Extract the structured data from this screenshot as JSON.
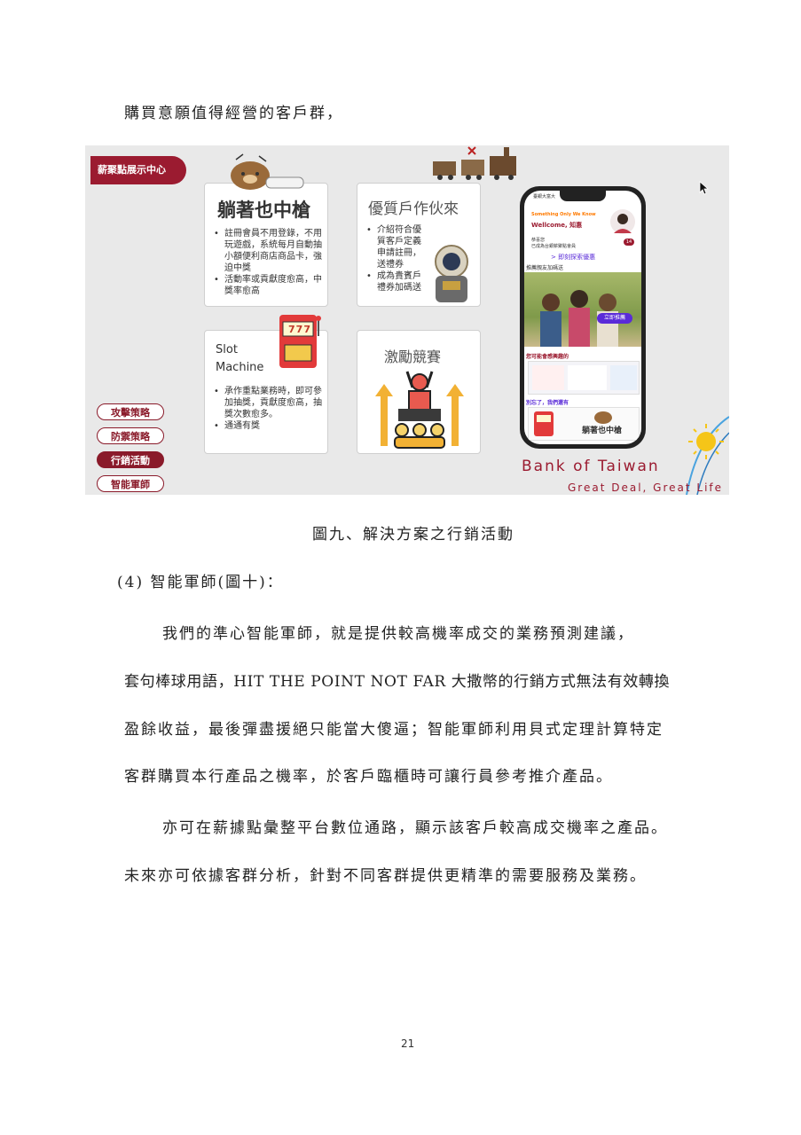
{
  "intro_line": "購買意願值得經營的客戶群，",
  "slide": {
    "tag": "薪聚點展示中心",
    "card1": {
      "title": "躺著也中槍",
      "bullets": [
        "註冊會員不用登錄，不用玩遊戲，系統每月自動抽小額便利商店商品卡，強迫中獎",
        "活動率或貢獻度愈高，中獎率愈高"
      ]
    },
    "card2": {
      "title": "優質戶作伙來",
      "bullets": [
        "介紹符合優質客戶定義申請註冊，送禮券",
        "成為貴賓戶禮券加碼送"
      ]
    },
    "card3": {
      "title_line1": "Slot",
      "title_line2": "Machine",
      "reels": "777",
      "bullets": [
        "承作重點業務時，即可參加抽獎，貢獻度愈高，抽獎次數愈多。",
        "通通有獎"
      ]
    },
    "card4": {
      "title": "激勵競賽"
    },
    "menu": [
      "攻擊策略",
      "防禦策略",
      "行銷活動",
      "智能軍師"
    ],
    "menu_active_index": 2,
    "phone": {
      "status_left": "臺銀大富大",
      "banner": "Something Only We Know",
      "welcome": "Wellcome, 知惠",
      "line1": "恭喜您",
      "line2": "已成為台銀薪聚點會員",
      "badge": "14",
      "link": "> 即刻探索優惠",
      "refer": "推薦親友加碼送",
      "cta": "立即推薦",
      "interest": "您可能會感興趣的",
      "forgot": "別忘了，我們還有",
      "footer_logo": "躺著也中槍"
    },
    "brand": "Bank of Taiwan",
    "slogan": "Great Deal, Great Life"
  },
  "caption": "圖九、解決方案之行銷活動",
  "section_heading": "(4) 智能軍師(圖十)：",
  "paragraph1": [
    "我們的準心智能軍師，就是提供較高機率成交的業務預測建議，",
    "套句棒球用語，HIT THE POINT NOT FAR 大撒幣的行銷方式無法有效轉換",
    "盈餘收益，最後彈盡援絕只能當大傻逼；智能軍師利用貝式定理計算特定",
    "客群購買本行產品之機率，於客戶臨櫃時可讓行員參考推介產品。"
  ],
  "paragraph2": [
    "亦可在薪據點彙整平台數位通路，顯示該客戶較高成交機率之產品。",
    "未來亦可依據客群分析，針對不同客群提供更精準的需要服務及業務。"
  ],
  "page_number": "21",
  "colors": {
    "brand": "#9b1b30",
    "accent_purple": "#5a2bd8",
    "sun": "#f5c518"
  }
}
